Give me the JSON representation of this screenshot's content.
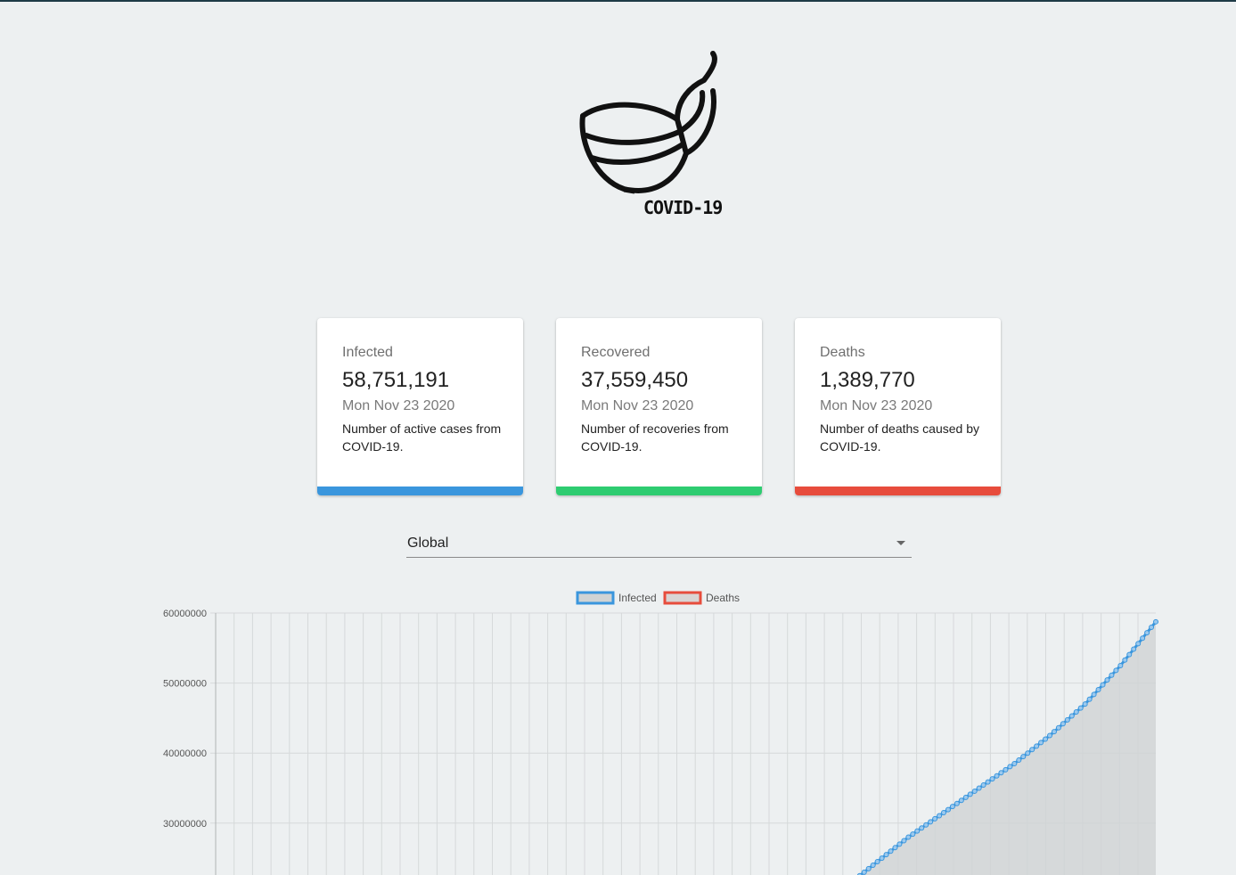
{
  "logo": {
    "text": "COVID-19"
  },
  "cards": [
    {
      "title": "Infected",
      "value": "58,751,191",
      "date": "Mon Nov 23 2020",
      "description": "Number of active cases from COVID-19.",
      "color": "#3a96dd"
    },
    {
      "title": "Recovered",
      "value": "37,559,450",
      "date": "Mon Nov 23 2020",
      "description": "Number of recoveries from COVID-19.",
      "color": "#2ecc71"
    },
    {
      "title": "Deaths",
      "value": "1,389,770",
      "date": "Mon Nov 23 2020",
      "description": "Number of deaths caused by COVID-19.",
      "color": "#e74c3c"
    }
  ],
  "country_select": {
    "value": "Global"
  },
  "chart_data": {
    "type": "line",
    "legend": [
      "Infected",
      "Deaths"
    ],
    "legend_position": "top-center",
    "grid": true,
    "y_ticks": [
      "60000000",
      "50000000",
      "40000000",
      "30000000"
    ],
    "ylim": [
      0,
      60000000
    ],
    "series": [
      {
        "name": "Infected",
        "color": "#3a96dd",
        "fill": "#cfd3d4",
        "values_visible_tail": [
          20000000,
          24000000,
          28000000,
          31500000,
          35000000,
          38500000,
          42500000,
          47000000,
          52500000,
          58751191
        ]
      },
      {
        "name": "Deaths",
        "color": "#e74c3c",
        "fill": "#f4c7c2",
        "values_visible_tail": []
      }
    ]
  }
}
